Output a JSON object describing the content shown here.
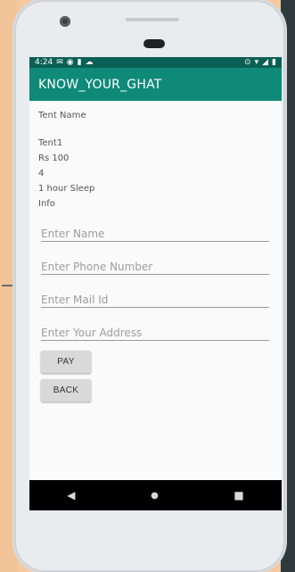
{
  "status_bar": {
    "time": "4:24",
    "left_icons": [
      "mail-icon",
      "photo-icon",
      "sim-icon",
      "cloud-icon"
    ],
    "right_icons": [
      "location-icon",
      "wifi-icon",
      "signal-icon",
      "battery-icon"
    ]
  },
  "app_bar": {
    "title": "KNOW_YOUR_GHAT"
  },
  "details": {
    "label": "Tent Name",
    "name": "Tent1",
    "price": "Rs 100",
    "capacity": "4",
    "duration": "1 hour Sleep",
    "info": "Info"
  },
  "form": {
    "name_placeholder": "Enter Name",
    "phone_placeholder": "Enter Phone Number",
    "mail_placeholder": "Enter Mail Id",
    "address_placeholder": "Enter Your Address"
  },
  "buttons": {
    "pay": "PAY",
    "back": "BACK"
  },
  "nav": {
    "back_icon": "back-triangle-icon",
    "home_icon": "home-circle-icon",
    "recents_icon": "recents-square-icon"
  },
  "colors": {
    "status_bar": "#0b5f55",
    "app_bar": "#0f8a79",
    "button_bg": "#d9d9d9",
    "background_left": "#f5c9a0"
  }
}
